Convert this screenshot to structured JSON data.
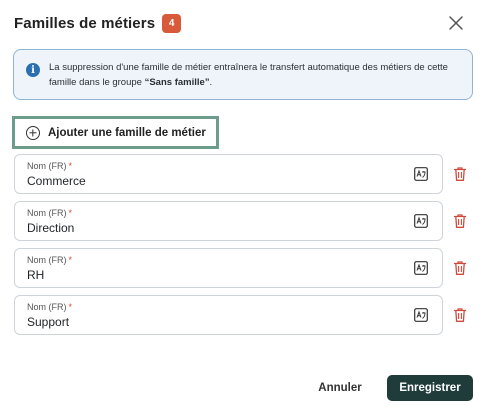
{
  "dialog": {
    "title": "Familles de métiers",
    "count": "4"
  },
  "info": {
    "text_before": "La suppression d'une famille de métier entraînera le transfert automatique des métiers de cette famille dans le groupe ",
    "group_name": "“Sans famille”",
    "text_after": "."
  },
  "add_button": {
    "label": "Ajouter une famille de métier"
  },
  "field_label": "Nom (FR)",
  "required_mark": "*",
  "families": [
    {
      "value": "Commerce"
    },
    {
      "value": "Direction"
    },
    {
      "value": "RH"
    },
    {
      "value": "Support"
    }
  ],
  "footer": {
    "cancel_label": "Annuler",
    "save_label": "Enregistrer"
  },
  "colors": {
    "badge": "#d95a3a",
    "info_bg": "#eef4fa",
    "info_border": "#8fb4d6",
    "primary": "#1f3c3a",
    "delete": "#d04a3a",
    "focus_outline": "#6e9c8a"
  },
  "icons": {
    "close": "close-icon",
    "info": "info-icon",
    "add": "plus-circle-icon",
    "translate": "translate-icon",
    "delete": "trash-icon"
  }
}
